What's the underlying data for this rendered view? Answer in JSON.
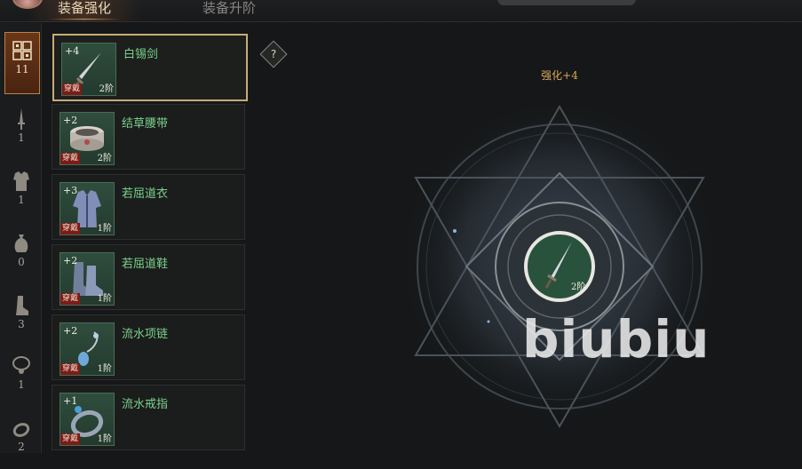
{
  "tabs": [
    {
      "label": "装备强化",
      "active": true
    },
    {
      "label": "装备升阶",
      "active": false
    }
  ],
  "categories": [
    {
      "icon": "grid-icon",
      "count": "11",
      "active": true
    },
    {
      "icon": "sword-icon",
      "count": "1"
    },
    {
      "icon": "armor-icon",
      "count": "1"
    },
    {
      "icon": "pouch-icon",
      "count": "0"
    },
    {
      "icon": "boot-icon",
      "count": "3"
    },
    {
      "icon": "necklace-icon",
      "count": "1"
    },
    {
      "icon": "ring-icon",
      "count": "2"
    }
  ],
  "equipment": [
    {
      "name": "白锡剑",
      "plus": "+4",
      "worn": "穿戴",
      "tier": "2阶",
      "icon": "sword-icon",
      "selected": true
    },
    {
      "name": "结草腰带",
      "plus": "+2",
      "worn": "穿戴",
      "tier": "2阶",
      "icon": "belt-icon"
    },
    {
      "name": "若屈道衣",
      "plus": "+3",
      "worn": "穿戴",
      "tier": "1阶",
      "icon": "robe-icon"
    },
    {
      "name": "若屈道鞋",
      "plus": "+2",
      "worn": "穿戴",
      "tier": "1阶",
      "icon": "boot-icon"
    },
    {
      "name": "流水项链",
      "plus": "+2",
      "worn": "穿戴",
      "tier": "1阶",
      "icon": "necklace-icon"
    },
    {
      "name": "流水戒指",
      "plus": "+1",
      "worn": "穿戴",
      "tier": "1阶",
      "icon": "ring-icon"
    }
  ],
  "help": {
    "label": "?"
  },
  "enhance": {
    "label": "强化+4",
    "center_tier": "2阶"
  },
  "watermark": "biubiu",
  "colors": {
    "accent": "#c7ac77",
    "item_name": "#7bd28d",
    "worn_badge": "#7a1d18",
    "level_label": "#d9a95a"
  }
}
